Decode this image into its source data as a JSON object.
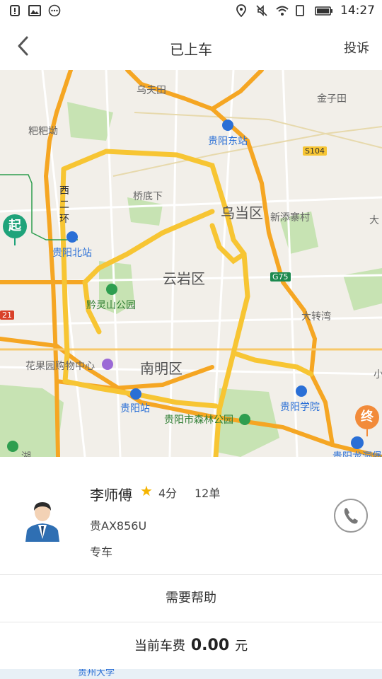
{
  "status_bar": {
    "time": "14:27"
  },
  "nav": {
    "title": "已上车",
    "action": "投诉"
  },
  "map": {
    "labels": {
      "wutiantian": "乌夫田",
      "jinzitian": "金子田",
      "bababao": "粑粑坳",
      "guiyang_east": "贵阳东站",
      "s104": "S104",
      "xi": "西",
      "er": "二",
      "huan": "环",
      "qiaodixia": "桥底下",
      "wudangqu": "乌当区",
      "xintianzhai": "新添寨村",
      "da": "大",
      "guiyang_north": "贵阳北站",
      "yunyanqu": "云岩区",
      "g75": "G75",
      "qianlingshan": "黔灵山公园",
      "dazhuanwan": "大转湾",
      "n21": "21",
      "huaguoyuan": "花果园购物中心",
      "nanmingqu": "南明区",
      "xiao": "小",
      "guiyang_station": "贵阳站",
      "guiyang_xueyuan": "贵阳学院",
      "senlin_park": "贵阳市森林公园",
      "longdongbao": "贵阳龙洞堡",
      "hu": "湖",
      "start": "起",
      "end": "终"
    }
  },
  "driver": {
    "name": "李师傅",
    "rating": "4分",
    "orders": "12单",
    "plate": "贵AX856U",
    "service": "专车"
  },
  "help": {
    "label": "需要帮助"
  },
  "fare": {
    "prefix": "当前车费",
    "amount": "0.00",
    "unit": "元"
  },
  "bottom": {
    "text": "贵州大学"
  },
  "colors": {
    "road_major": "#f5a623",
    "road_ring": "#f7c533",
    "green": "#c7e3b3",
    "accent_blue": "#2a6fd6",
    "start_pin": "#1fa37a",
    "end_pin": "#f28b3a"
  }
}
